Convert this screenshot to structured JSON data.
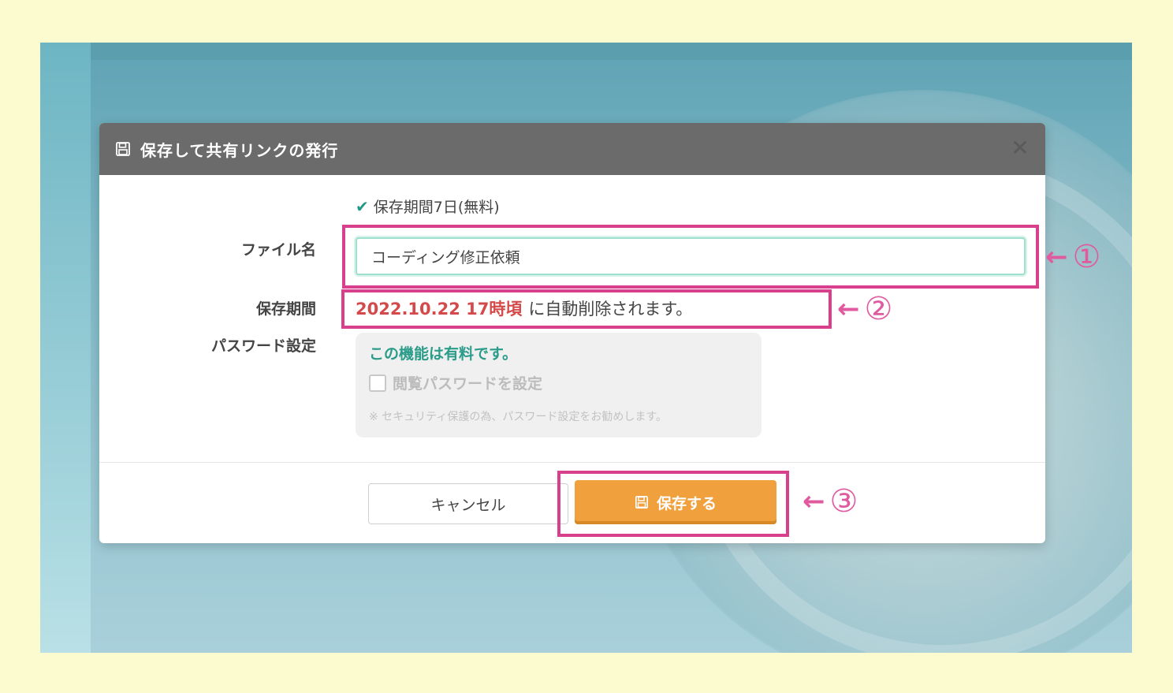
{
  "dialog": {
    "title": "保存して共有リンクの発行",
    "close_label": "✕",
    "icon": "save-icon"
  },
  "form": {
    "retention_note": "保存期間7日(無料)",
    "file_label": "ファイル名",
    "file_value": "コーディング修正依頼",
    "period_label": "保存期間",
    "period_date": "2022.10.22 17時頃",
    "period_suffix": "に自動削除されます。",
    "password_label": "パスワード設定",
    "password_notice": "この機能は有料です。",
    "password_checkbox_label": "閲覧パスワードを設定",
    "password_hint": "※ セキュリティ保護の為、パスワード設定をお勧めします。"
  },
  "buttons": {
    "cancel": "キャンセル",
    "save": "保存する"
  },
  "annotations": {
    "marker_1": "①",
    "marker_2": "②",
    "marker_3": "③",
    "highlight_color": "#d83f8c"
  },
  "colors": {
    "accent_orange": "#f0a03d",
    "teal": "#2b9c8a",
    "date_red": "#d44a4a",
    "header_gray": "#6b6b6b",
    "page_background": "#fcfbd0"
  }
}
